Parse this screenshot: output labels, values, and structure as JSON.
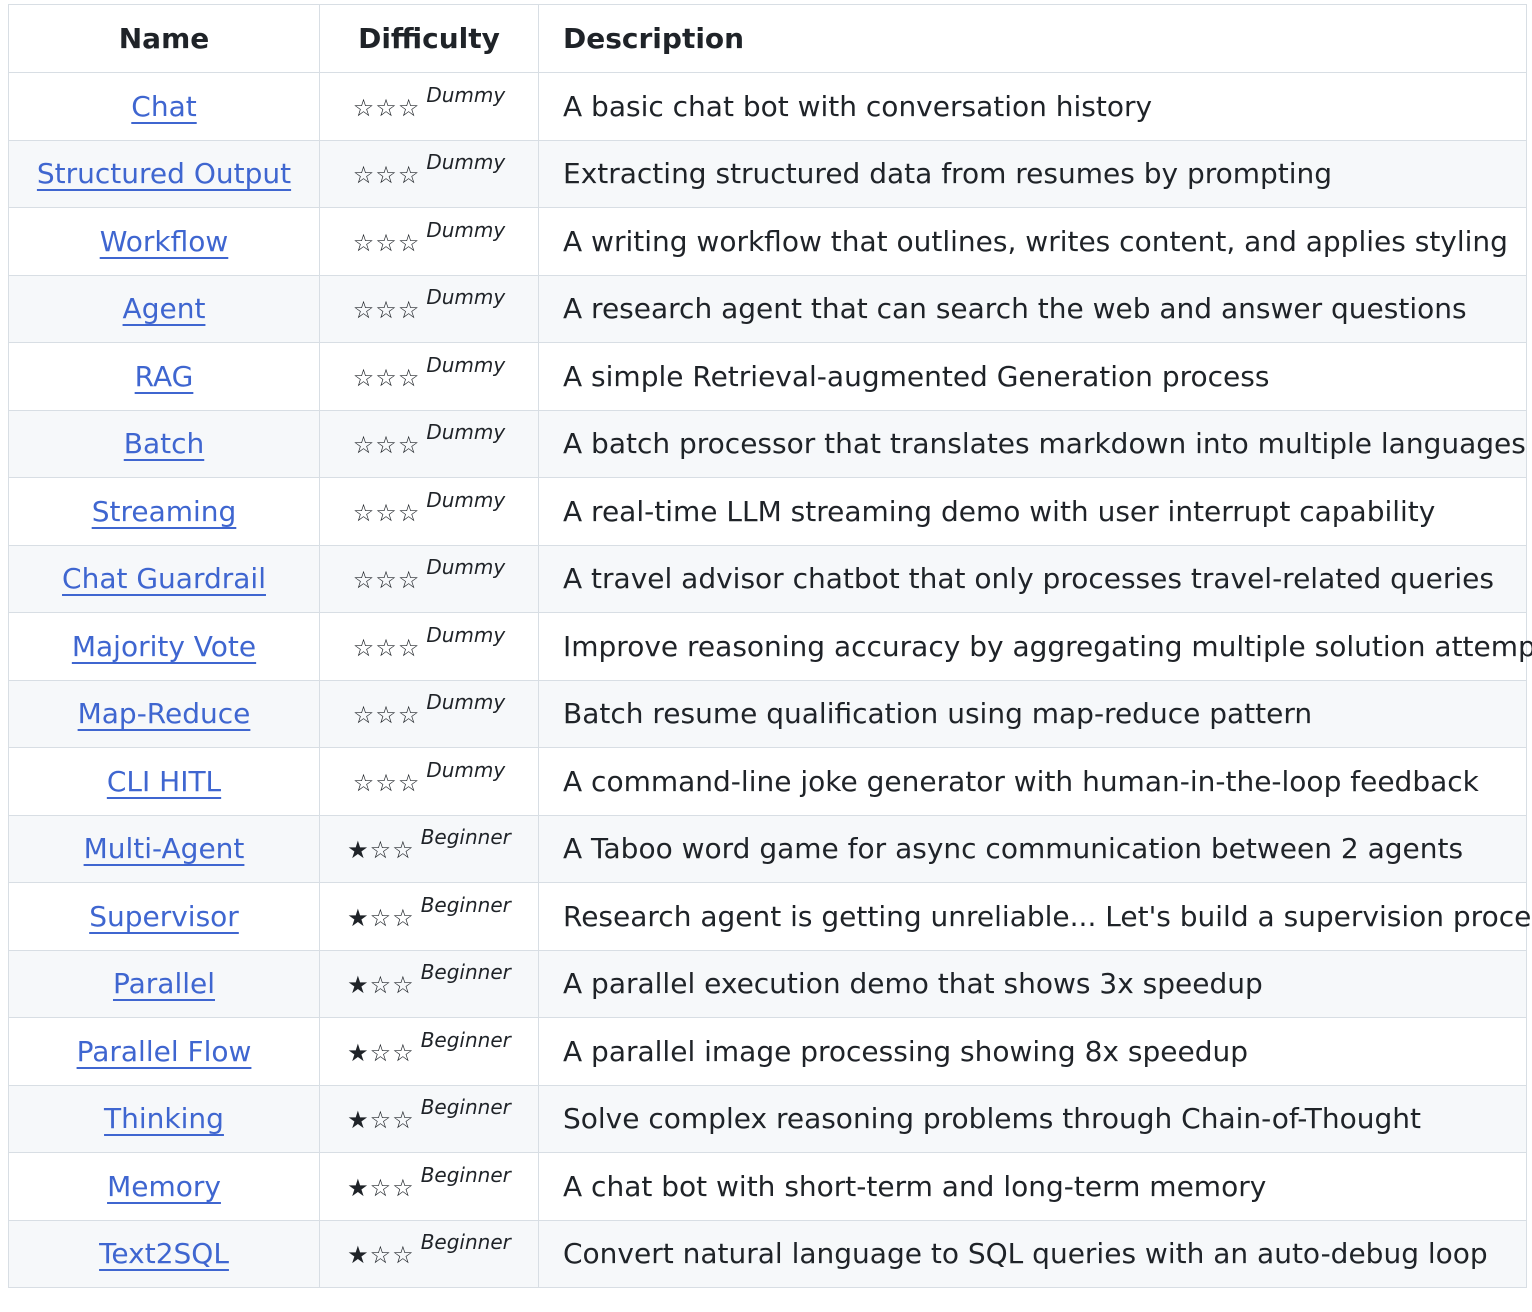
{
  "table": {
    "headers": {
      "name": "Name",
      "difficulty": "Difficulty",
      "description": "Description"
    },
    "rows": [
      {
        "name": "Chat",
        "stars": "☆☆☆",
        "level": "Dummy",
        "description": "A basic chat bot with conversation history"
      },
      {
        "name": "Structured Output",
        "stars": "☆☆☆",
        "level": "Dummy",
        "description": "Extracting structured data from resumes by prompting"
      },
      {
        "name": "Workflow",
        "stars": "☆☆☆",
        "level": "Dummy",
        "description": "A writing workflow that outlines, writes content, and applies styling"
      },
      {
        "name": "Agent",
        "stars": "☆☆☆",
        "level": "Dummy",
        "description": "A research agent that can search the web and answer questions"
      },
      {
        "name": "RAG",
        "stars": "☆☆☆",
        "level": "Dummy",
        "description": "A simple Retrieval-augmented Generation process"
      },
      {
        "name": "Batch",
        "stars": "☆☆☆",
        "level": "Dummy",
        "description": "A batch processor that translates markdown into multiple languages"
      },
      {
        "name": "Streaming",
        "stars": "☆☆☆",
        "level": "Dummy",
        "description": "A real-time LLM streaming demo with user interrupt capability"
      },
      {
        "name": "Chat Guardrail",
        "stars": "☆☆☆",
        "level": "Dummy",
        "description": "A travel advisor chatbot that only processes travel-related queries"
      },
      {
        "name": "Majority Vote",
        "stars": "☆☆☆",
        "level": "Dummy",
        "description": "Improve reasoning accuracy by aggregating multiple solution attempts"
      },
      {
        "name": "Map-Reduce",
        "stars": "☆☆☆",
        "level": "Dummy",
        "description": "Batch resume qualification using map-reduce pattern"
      },
      {
        "name": "CLI HITL",
        "stars": "☆☆☆",
        "level": "Dummy",
        "description": "A command-line joke generator with human-in-the-loop feedback"
      },
      {
        "name": "Multi-Agent",
        "stars": "★☆☆",
        "level": "Beginner",
        "description": "A Taboo word game for async communication between 2 agents"
      },
      {
        "name": "Supervisor",
        "stars": "★☆☆",
        "level": "Beginner",
        "description": "Research agent is getting unreliable... Let's build a supervision process"
      },
      {
        "name": "Parallel",
        "stars": "★☆☆",
        "level": "Beginner",
        "description": "A parallel execution demo that shows 3x speedup"
      },
      {
        "name": "Parallel Flow",
        "stars": "★☆☆",
        "level": "Beginner",
        "description": "A parallel image processing showing 8x speedup"
      },
      {
        "name": "Thinking",
        "stars": "★☆☆",
        "level": "Beginner",
        "description": "Solve complex reasoning problems through Chain-of-Thought"
      },
      {
        "name": "Memory",
        "stars": "★☆☆",
        "level": "Beginner",
        "description": "A chat bot with short-term and long-term memory"
      },
      {
        "name": "Text2SQL",
        "stars": "★☆☆",
        "level": "Beginner",
        "description": "Convert natural language to SQL queries with an auto-debug loop"
      }
    ]
  },
  "colors": {
    "link": "#3f66d0",
    "border": "#d8dee4",
    "stripe": "#f6f8fa",
    "text": "#1f2328"
  }
}
